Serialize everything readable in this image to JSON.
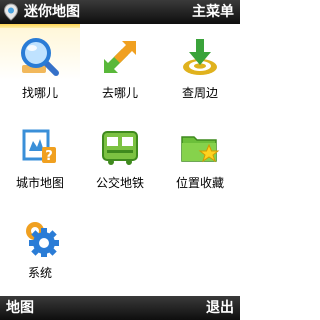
{
  "header": {
    "title": "迷你地图",
    "menu_label": "主菜单",
    "logo_icon": "app-logo-icon"
  },
  "grid": {
    "items": [
      {
        "label": "找哪儿",
        "icon": "magnifier-icon",
        "selected": true
      },
      {
        "label": "去哪儿",
        "icon": "route-arrows-icon",
        "selected": false
      },
      {
        "label": "查周边",
        "icon": "location-pin-icon",
        "selected": false
      },
      {
        "label": "城市地图",
        "icon": "city-map-icon",
        "selected": false
      },
      {
        "label": "公交地铁",
        "icon": "bus-icon",
        "selected": false
      },
      {
        "label": "位置收藏",
        "icon": "favorite-folder-icon",
        "selected": false
      },
      {
        "label": "系统",
        "icon": "settings-gear-icon",
        "selected": false
      }
    ]
  },
  "softkeys": {
    "left": "地图",
    "right": "退出"
  },
  "colors": {
    "bar_background": "#1e1e1e",
    "selection_highlight": "#ffd451",
    "text": "#000000"
  }
}
